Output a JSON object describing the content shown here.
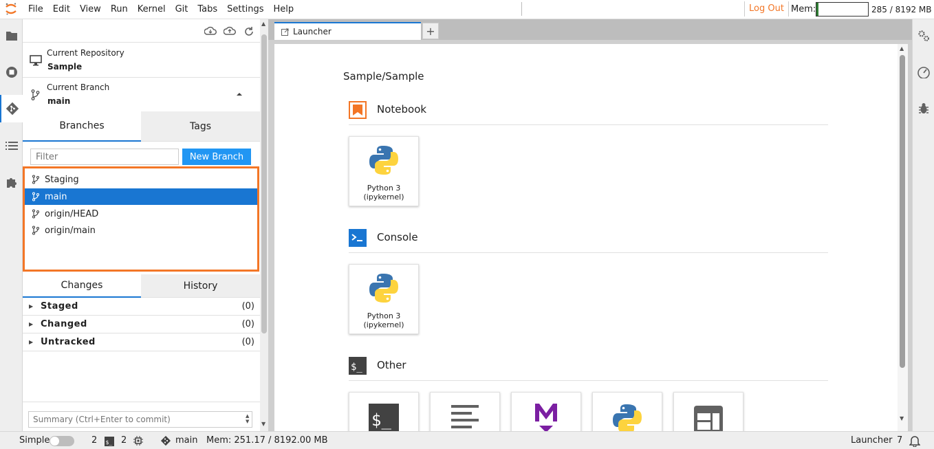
{
  "menu": [
    "File",
    "Edit",
    "View",
    "Run",
    "Kernel",
    "Git",
    "Tabs",
    "Settings",
    "Help"
  ],
  "topbar": {
    "logout_label": "Log Out",
    "mem_label": "Mem:",
    "mem_value": "285 / 8192 MB",
    "mem_fraction": 0.035
  },
  "git": {
    "current_repo_label": "Current Repository",
    "current_repo_value": "Sample",
    "current_branch_label": "Current Branch",
    "current_branch_value": "main",
    "tabs": [
      "Branches",
      "Tags"
    ],
    "filter_placeholder": "Filter",
    "new_branch_label": "New Branch",
    "branches": [
      "Staging",
      "main",
      "origin/HEAD",
      "origin/main"
    ],
    "selected_branch": "main",
    "change_tabs": [
      "Changes",
      "History"
    ],
    "changes": [
      {
        "label": "Staged",
        "count": "(0)"
      },
      {
        "label": "Changed",
        "count": "(0)"
      },
      {
        "label": "Untracked",
        "count": "(0)"
      }
    ],
    "summary_placeholder": "Summary (Ctrl+Enter to commit)"
  },
  "main": {
    "tab_label": "Launcher",
    "add_tab": "+",
    "breadcrumb": "Sample/Sample",
    "sections": {
      "notebook": "Notebook",
      "console": "Console",
      "other": "Other"
    },
    "kernel_card": {
      "line1": "Python 3",
      "line2": "(ipykernel)"
    }
  },
  "statusbar": {
    "mode_label": "Simple",
    "terminals_count": "2",
    "kernels_count": "2",
    "branch": "main",
    "mem": "Mem: 251.17 / 8192.00 MB",
    "right_label": "Launcher",
    "notifications": "7"
  },
  "colors": {
    "accent": "#1976d2",
    "jupyter_orange": "#f37626",
    "button_blue": "#2196f3"
  }
}
